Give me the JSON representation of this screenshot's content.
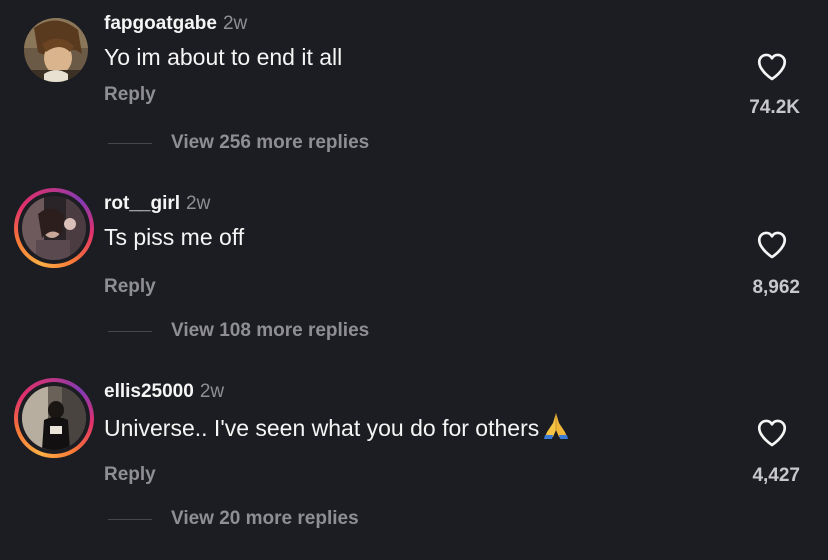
{
  "comments": [
    {
      "username": "fapgoatgabe",
      "time": "2w",
      "text": "Yo im about to end it all",
      "reply_label": "Reply",
      "likes": "74.2K",
      "view_replies": "View 256 more replies",
      "avatar_ring": false
    },
    {
      "username": "rot__girl",
      "time": "2w",
      "text": "Ts piss me off",
      "reply_label": "Reply",
      "likes": "8,962",
      "view_replies": "View 108 more replies",
      "avatar_ring": true
    },
    {
      "username": "ellis25000",
      "time": "2w",
      "text": "Universe.. I've seen what you do for others",
      "reply_label": "Reply",
      "likes": "4,427",
      "view_replies": "View 20 more replies",
      "avatar_ring": true
    }
  ],
  "colors": {
    "background": "#1c1d22",
    "primary_text": "#f5f5f5",
    "secondary_text": "#8e8e93",
    "story_ring_start": "#fcaf45",
    "story_ring_end": "#c13584"
  },
  "icons": {
    "like": "heart-outline-icon",
    "text_emoji": "folded-hands-emoji"
  }
}
